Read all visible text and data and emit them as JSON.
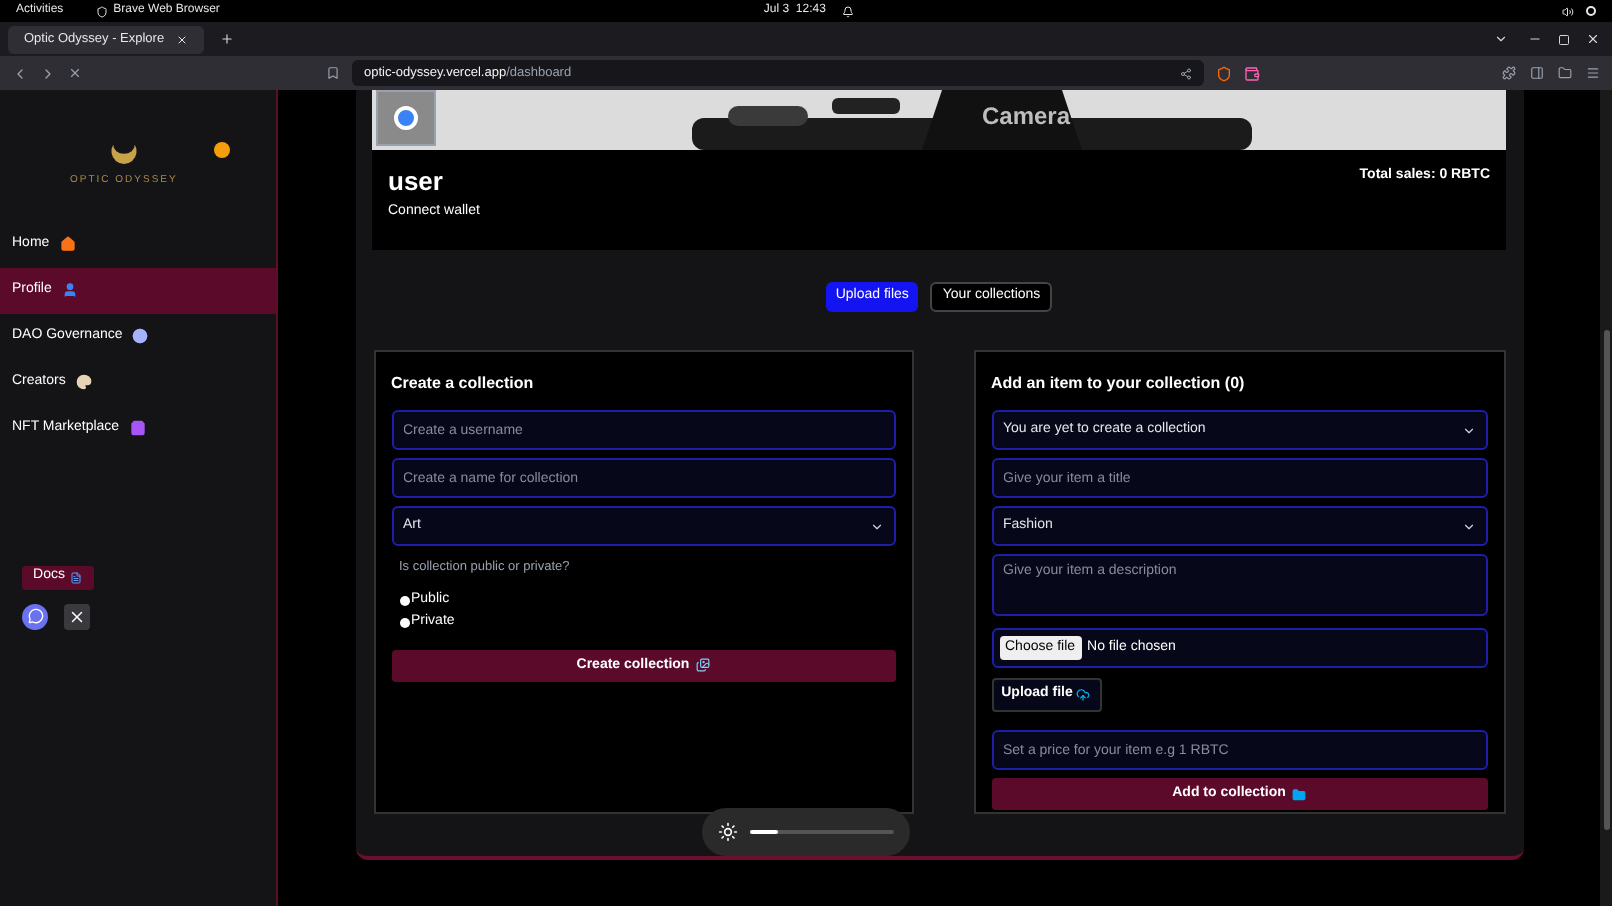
{
  "system_bar": {
    "activities": "Activities",
    "app": "Brave Web Browser",
    "clock": "Jul 3  12:43"
  },
  "browser": {
    "tab_title": "Optic Odyssey - Explore",
    "url_host": "optic-odyssey.vercel.app",
    "url_path": "/dashboard"
  },
  "sidebar": {
    "logo_text": "OPTIC ODYSSEY",
    "items": [
      {
        "label": "Home",
        "selected": false,
        "color": "#f97316"
      },
      {
        "label": "Profile",
        "selected": true,
        "color": "#3b82f6"
      },
      {
        "label": "DAO Governance",
        "selected": false,
        "color": "#a5b4fc"
      },
      {
        "label": "Creators",
        "selected": false,
        "color": "#e7d3b5"
      },
      {
        "label": "NFT Marketplace",
        "selected": false,
        "color": "#a855f7"
      }
    ],
    "docs": "Docs"
  },
  "profile": {
    "banner_text": "Camera",
    "name": "user",
    "wallet": "Connect wallet",
    "total_sales": "Total sales: 0 RBTC"
  },
  "tabs": [
    {
      "label": "Upload files",
      "selected": true
    },
    {
      "label": "Your collections",
      "selected": false
    }
  ],
  "create_form": {
    "title": "Create a collection",
    "username_placeholder": "Create a username",
    "name_placeholder": "Create a name for collection",
    "category": "Art",
    "question": "Is collection public or private?",
    "radios": [
      {
        "label": "Public",
        "selected": false
      },
      {
        "label": "Private",
        "selected": false
      }
    ],
    "button": "Create collection"
  },
  "item_form": {
    "title": "Add an item to your collection (0)",
    "collection": "You are yet to create a collection",
    "title_placeholder": "Give your item a title",
    "category": "Fashion",
    "description_placeholder": "Give your item a description",
    "choose_file": "Choose file",
    "file_status": "No file chosen",
    "upload": "Upload file",
    "price_placeholder": "Set a price for your item e.g 1 RBTC",
    "button": "Add to collection"
  },
  "brightness": {
    "level": 0.2
  }
}
